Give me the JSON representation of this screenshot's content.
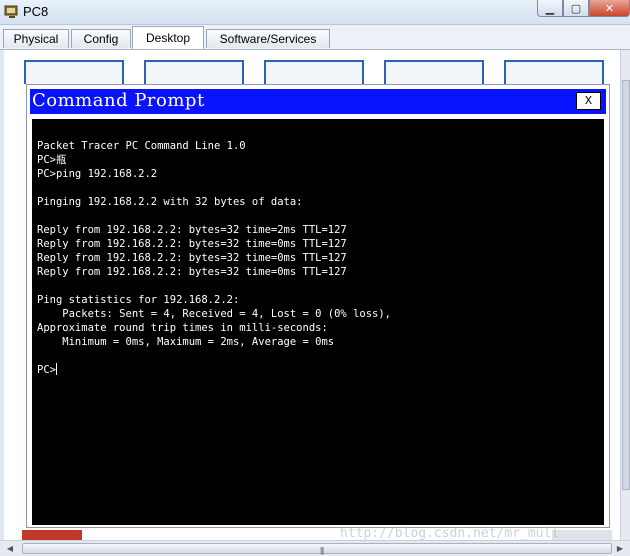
{
  "window": {
    "title": "PC8"
  },
  "tabs": [
    {
      "label": "Physical"
    },
    {
      "label": "Config"
    },
    {
      "label": "Desktop"
    },
    {
      "label": "Software/Services"
    }
  ],
  "cmd": {
    "title": "Command Prompt",
    "close_label": "X",
    "lines": [
      "Packet Tracer PC Command Line 1.0",
      "PC>瓶",
      "PC>ping 192.168.2.2",
      "",
      "Pinging 192.168.2.2 with 32 bytes of data:",
      "",
      "Reply from 192.168.2.2: bytes=32 time=2ms TTL=127",
      "Reply from 192.168.2.2: bytes=32 time=0ms TTL=127",
      "Reply from 192.168.2.2: bytes=32 time=0ms TTL=127",
      "Reply from 192.168.2.2: bytes=32 time=0ms TTL=127",
      "",
      "Ping statistics for 192.168.2.2:",
      "    Packets: Sent = 4, Received = 4, Lost = 0 (0% loss),",
      "Approximate round trip times in milli-seconds:",
      "    Minimum = 0ms, Maximum = 2ms, Average = 0ms",
      ""
    ],
    "prompt": "PC>"
  },
  "watermark": "http://blog.csdn.net/mr_mull"
}
